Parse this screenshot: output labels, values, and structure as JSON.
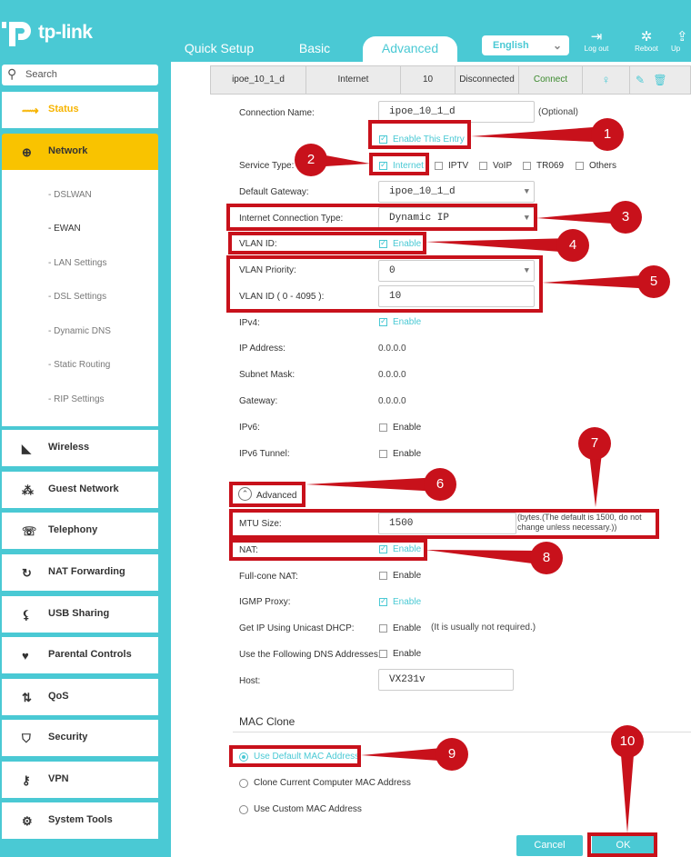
{
  "header": {
    "logo_text": "tp-link",
    "tabs": [
      {
        "label": "Quick Setup"
      },
      {
        "label": "Basic"
      },
      {
        "label": "Advanced"
      }
    ],
    "language": "English",
    "actions": [
      {
        "label": "Log out",
        "icon": "logout-icon"
      },
      {
        "label": "Reboot",
        "icon": "reboot-icon"
      },
      {
        "label": "Up",
        "icon": "upgrade-icon"
      }
    ]
  },
  "sidebar": {
    "search_placeholder": "Search",
    "items": [
      {
        "label": "Status",
        "icon": "pulse-icon"
      },
      {
        "label": "Network",
        "icon": "globe-icon"
      },
      {
        "label": "Wireless",
        "icon": "wifi-icon"
      },
      {
        "label": "Guest Network",
        "icon": "guests-icon"
      },
      {
        "label": "Telephony",
        "icon": "phone-icon"
      },
      {
        "label": "NAT Forwarding",
        "icon": "nat-icon"
      },
      {
        "label": "USB Sharing",
        "icon": "usb-icon"
      },
      {
        "label": "Parental Controls",
        "icon": "heart-icon"
      },
      {
        "label": "QoS",
        "icon": "qos-icon"
      },
      {
        "label": "Security",
        "icon": "shield-icon"
      },
      {
        "label": "VPN",
        "icon": "vpn-icon"
      },
      {
        "label": "System Tools",
        "icon": "gear-icon"
      }
    ],
    "network_sub": [
      {
        "label": "- DSLWAN"
      },
      {
        "label": "- EWAN"
      },
      {
        "label": "- LAN Settings"
      },
      {
        "label": "- DSL Settings"
      },
      {
        "label": "- Dynamic DNS"
      },
      {
        "label": "- Static Routing"
      },
      {
        "label": "- RIP Settings"
      }
    ]
  },
  "table_row": {
    "name": "ipoe_10_1_d",
    "type": "Internet",
    "vlan": "10",
    "status": "Disconnected",
    "action": "Connect"
  },
  "form": {
    "connection_name_label": "Connection Name:",
    "connection_name_value": "ipoe_10_1_d",
    "optional": "(Optional)",
    "enable_entry": "Enable This Entry",
    "service_type_label": "Service Type:",
    "service_types": [
      "Internet",
      "IPTV",
      "VoIP",
      "TR069",
      "Others"
    ],
    "default_gateway_label": "Default Gateway:",
    "default_gateway_value": "ipoe_10_1_d",
    "conn_type_label": "Internet Connection Type:",
    "conn_type_value": "Dynamic IP",
    "vlan_id_label": "VLAN ID:",
    "enable": "Enable",
    "vlan_priority_label": "VLAN Priority:",
    "vlan_priority_value": "0",
    "vlan_id_range_label": "VLAN ID ( 0 - 4095 ):",
    "vlan_id_value": "10",
    "ipv4_label": "IPv4:",
    "ip_address_label": "IP Address:",
    "ip_address_value": "0.0.0.0",
    "subnet_label": "Subnet Mask:",
    "subnet_value": "0.0.0.0",
    "gateway_label": "Gateway:",
    "gateway_value": "0.0.0.0",
    "ipv6_label": "IPv6:",
    "ipv6_tunnel_label": "IPv6 Tunnel:",
    "advanced_label": "Advanced",
    "mtu_label": "MTU Size:",
    "mtu_value": "1500",
    "mtu_hint": "(bytes.(The default is 1500, do not change unless necessary.))",
    "nat_label": "NAT:",
    "fullcone_label": "Full-cone NAT:",
    "igmp_label": "IGMP Proxy:",
    "unicast_label": "Get IP Using Unicast DHCP:",
    "unicast_hint": "(It is usually not required.)",
    "dns_label": "Use the Following DNS Addresses:",
    "host_label": "Host:",
    "host_value": "VX231v",
    "mac_clone_title": "MAC Clone",
    "mac_options": [
      "Use Default MAC Address",
      "Clone Current Computer MAC Address",
      "Use Custom MAC Address"
    ],
    "cancel": "Cancel",
    "ok": "OK"
  },
  "callouts": [
    "1",
    "2",
    "3",
    "4",
    "5",
    "6",
    "7",
    "8",
    "9",
    "10"
  ],
  "colors": {
    "accent": "#4ac9d4",
    "highlight": "#c8111b",
    "active_menu": "#f9c300"
  }
}
